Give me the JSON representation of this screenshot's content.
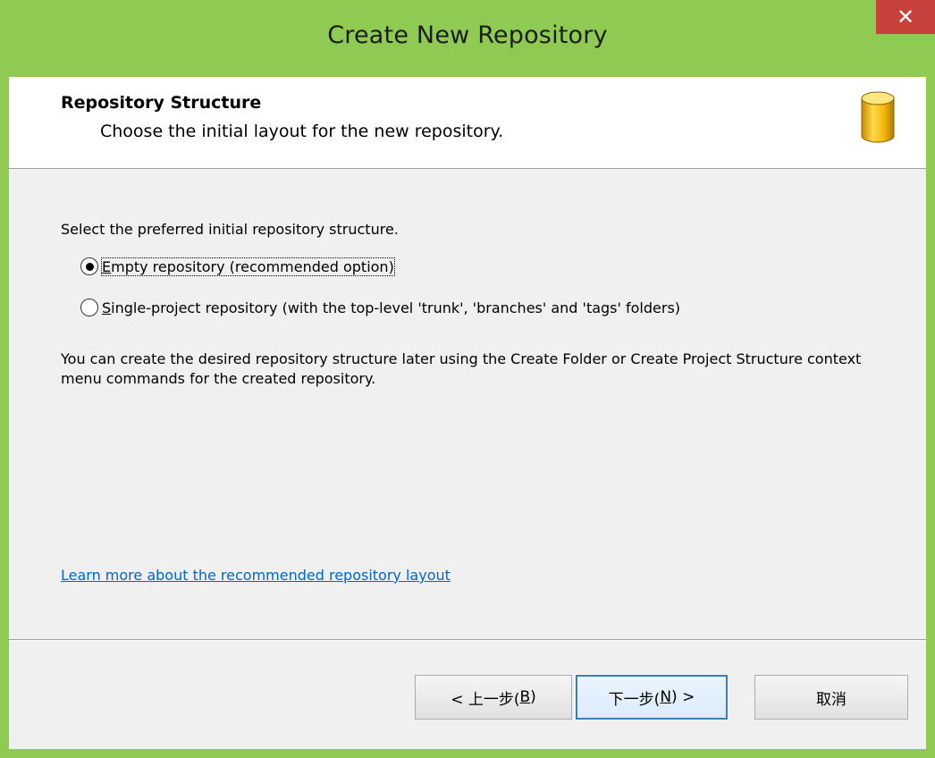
{
  "window": {
    "title": "Create New Repository",
    "close_glyph": "✕"
  },
  "header": {
    "title": "Repository Structure",
    "subtitle": "Choose the initial layout for the new repository.",
    "icon": "database-icon"
  },
  "body": {
    "intro": "Select the preferred initial repository structure.",
    "options": [
      {
        "mnemonic": "E",
        "label_rest": "mpty repository (recommended option)",
        "selected": true
      },
      {
        "mnemonic": "S",
        "label_rest": "ingle-project repository (with the top-level 'trunk', 'branches' and 'tags' folders)",
        "selected": false
      }
    ],
    "note": "You can create the desired repository structure later using the Create Folder or Create Project Structure context menu commands for the created repository.",
    "link": "Learn more about the recommended repository layout"
  },
  "buttons": {
    "back_prefix": "< 上一步(",
    "back_key": "B",
    "back_suffix": ")",
    "next_prefix": "下一步(",
    "next_key": "N",
    "next_suffix": ") >",
    "cancel": "取消"
  },
  "colors": {
    "titlebar": "#8fca53",
    "close": "#c7413a",
    "link": "#0066cc",
    "focus_border": "#3c7fb1"
  }
}
